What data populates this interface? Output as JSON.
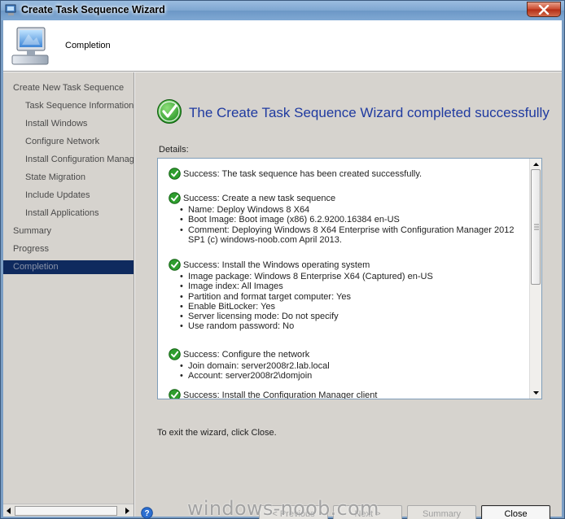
{
  "window": {
    "title": "Create Task Sequence Wizard"
  },
  "header": {
    "title": "Completion"
  },
  "nav": {
    "items": [
      {
        "label": "Create New Task Sequence",
        "level": 1,
        "active": false
      },
      {
        "label": "Task Sequence Information",
        "level": 2,
        "active": false
      },
      {
        "label": "Install Windows",
        "level": 2,
        "active": false
      },
      {
        "label": "Configure Network",
        "level": 2,
        "active": false
      },
      {
        "label": "Install Configuration Manag",
        "level": 2,
        "active": false
      },
      {
        "label": "State Migration",
        "level": 2,
        "active": false
      },
      {
        "label": "Include Updates",
        "level": 2,
        "active": false
      },
      {
        "label": "Install Applications",
        "level": 2,
        "active": false
      },
      {
        "label": "Summary",
        "level": 1,
        "active": false
      },
      {
        "label": "Progress",
        "level": 1,
        "active": false
      },
      {
        "label": "Completion",
        "level": 1,
        "active": true
      }
    ]
  },
  "main": {
    "heading": "The Create Task Sequence Wizard completed successfully",
    "details_label": "Details:",
    "details": [
      {
        "title": "Success: The task sequence has been created successfully.",
        "bullets": []
      },
      {
        "title": "Success: Create a new task sequence",
        "bullets": [
          "Name: Deploy Windows 8 X64",
          "Boot Image: Boot image (x86) 6.2.9200.16384 en-US",
          "Comment: Deploying Windows 8 X64 Enterprise with Configuration Manager 2012 SP1 (c) windows-noob.com April 2013."
        ]
      },
      {
        "title": "Success: Install the Windows operating system",
        "bullets": [
          "Image package: Windows 8 Enterprise X64 (Captured) en-US",
          "Image index: All Images",
          "Partition and format target computer: Yes",
          "Enable BitLocker: Yes",
          "Server licensing mode: Do not specify",
          "Use random password: No"
        ]
      },
      {
        "title": "Success: Configure the network",
        "bullets": [
          "Join domain: server2008r2.lab.local",
          "Account: server2008r2\\domjoin"
        ]
      },
      {
        "title": "Success: Install the Configuration Manager client",
        "bullets": []
      }
    ],
    "exit_text": "To exit the wizard, click Close."
  },
  "buttons": {
    "previous": "< Previous",
    "next": "Next >",
    "summary": "Summary",
    "close": "Close"
  },
  "watermark": "windows-noob.com",
  "colors": {
    "heading": "#1f3aa0",
    "success_green": "#2e9e2e",
    "nav_active": "#0f2a5e"
  }
}
